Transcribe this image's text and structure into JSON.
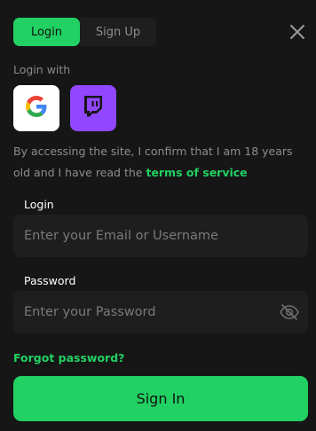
{
  "tabs": {
    "login": "Login",
    "signup": "Sign Up",
    "active": "login"
  },
  "close_icon": "close-icon",
  "social": {
    "heading": "Login with",
    "providers": [
      {
        "name": "google",
        "icon": "google-icon"
      },
      {
        "name": "twitch",
        "icon": "twitch-icon"
      }
    ]
  },
  "notice": {
    "text": "By accessing the site, I confirm that I am 18 years old and I have read the ",
    "link": "terms of service"
  },
  "form": {
    "login": {
      "label": "Login",
      "placeholder": "Enter your Email or Username",
      "value": ""
    },
    "password": {
      "label": "Password",
      "placeholder": "Enter your Password",
      "value": "",
      "toggle_icon": "eye-off-icon"
    },
    "forgot": "Forgot password?",
    "submit": "Sign In"
  },
  "colors": {
    "accent": "#22d163",
    "background": "#161616",
    "input_bg": "#1e1e1e",
    "twitch": "#9146ff"
  }
}
